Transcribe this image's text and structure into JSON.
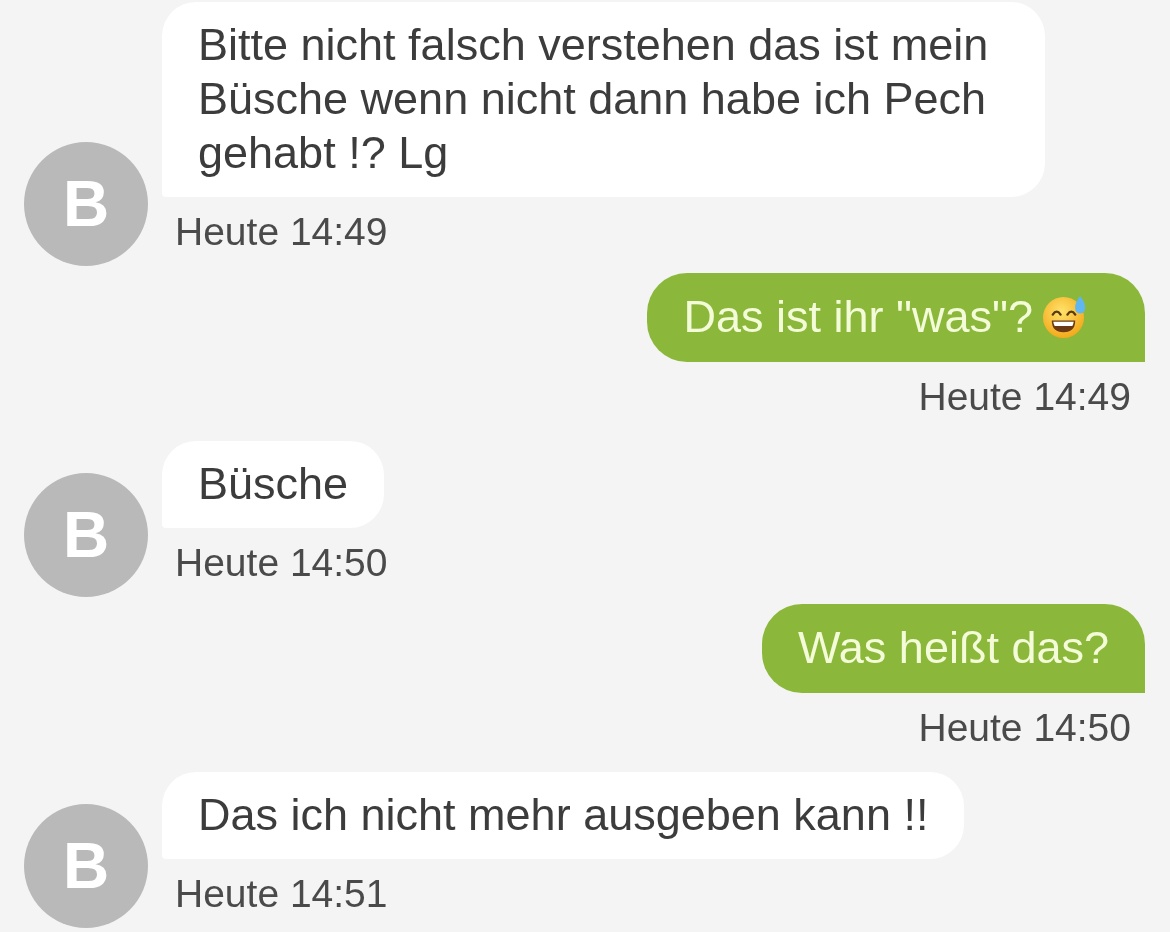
{
  "messages": [
    {
      "kind": "incoming",
      "avatar": "B",
      "text": "Bitte nicht falsch verstehen das ist mein Büsche wenn nicht dann habe ich Pech gehabt !? Lg",
      "emoji": false,
      "time": "Heute 14:49"
    },
    {
      "kind": "outgoing",
      "text": "Das ist ihr \"was\"?",
      "emoji": true,
      "time": "Heute 14:49"
    },
    {
      "kind": "incoming",
      "avatar": "B",
      "text": "Büsche",
      "emoji": false,
      "time": "Heute 14:50"
    },
    {
      "kind": "outgoing",
      "text": "Was heißt das?",
      "emoji": false,
      "time": "Heute 14:50"
    },
    {
      "kind": "incoming",
      "avatar": "B",
      "text": "Das ich nicht mehr ausgeben kann !!",
      "emoji": false,
      "time": "Heute 14:51"
    }
  ]
}
